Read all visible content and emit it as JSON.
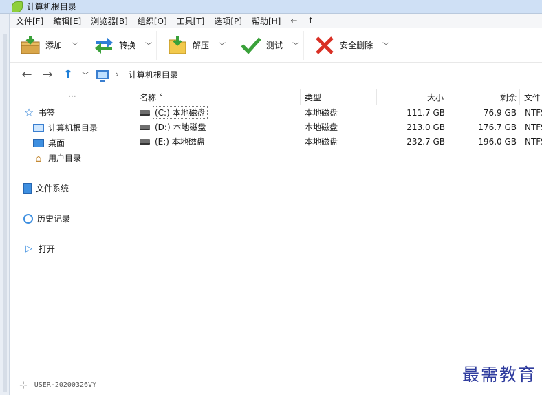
{
  "window": {
    "title": "计算机根目录"
  },
  "menu": [
    "文件[F]",
    "编辑[E]",
    "浏览器[B]",
    "组织[O]",
    "工具[T]",
    "选项[P]",
    "帮助[H]"
  ],
  "menu_symbols": [
    "←",
    "↑",
    "–"
  ],
  "toolbar": [
    {
      "label": "添加",
      "icon": "add-archive-icon"
    },
    {
      "label": "转换",
      "icon": "convert-icon"
    },
    {
      "label": "解压",
      "icon": "extract-icon"
    },
    {
      "label": "测试",
      "icon": "test-checkmark-icon"
    },
    {
      "label": "安全删除",
      "icon": "secure-delete-icon"
    }
  ],
  "address": {
    "crumb": "计算机根目录"
  },
  "sidebar": {
    "more": "···",
    "bookmarks": "书签",
    "items": [
      "计算机根目录",
      "桌面",
      "用户目录"
    ],
    "filesystem": "文件系统",
    "history": "历史记录",
    "open": "打开"
  },
  "columns": [
    "名称 ˂",
    "类型",
    "大小",
    "剩余",
    "文件"
  ],
  "rows": [
    {
      "name": "(C:) 本地磁盘",
      "type": "本地磁盘",
      "size": "111.7 GB",
      "free": "76.9 GB",
      "fs": "NTFS"
    },
    {
      "name": "(D:) 本地磁盘",
      "type": "本地磁盘",
      "size": "213.0 GB",
      "free": "176.7 GB",
      "fs": "NTFS"
    },
    {
      "name": "(E:) 本地磁盘",
      "type": "本地磁盘",
      "size": "232.7 GB",
      "free": "196.0 GB",
      "fs": "NTFS"
    }
  ],
  "status": {
    "host": "USER-20200326VY"
  },
  "watermark": "最需教育"
}
